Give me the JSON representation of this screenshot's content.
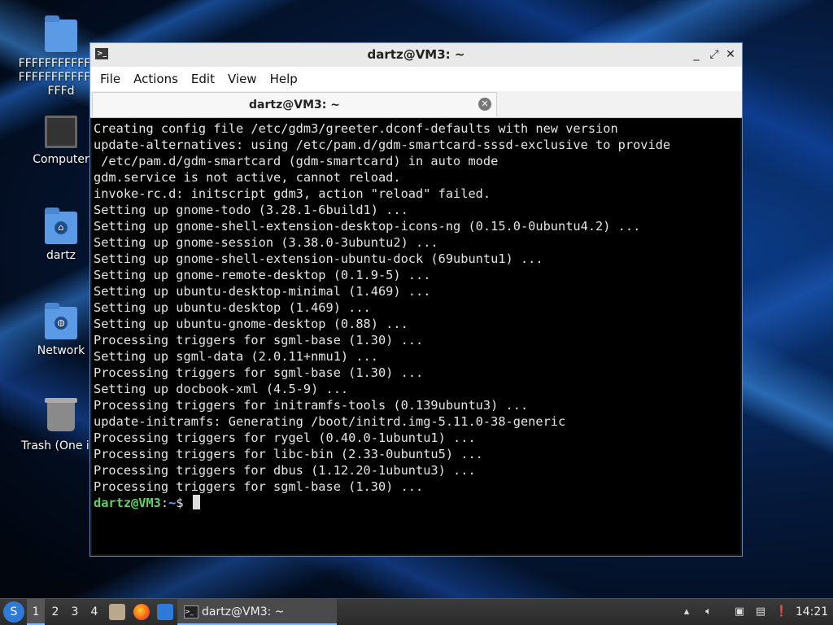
{
  "desktop": {
    "icons": [
      {
        "label": "FFFFFFFFFFFFFFFFFFFFFFFFFFFFFd"
      },
      {
        "label": "Computer"
      },
      {
        "label": "dartz"
      },
      {
        "label": "Network"
      },
      {
        "label": "Trash (One ite"
      }
    ]
  },
  "window": {
    "title": "dartz@VM3: ~",
    "controls": {
      "minimize": "_",
      "maximize": "⤢",
      "close": "✕"
    },
    "menu": [
      "File",
      "Actions",
      "Edit",
      "View",
      "Help"
    ],
    "tab": {
      "label": "dartz@VM3: ~",
      "close": "✕"
    },
    "terminal": {
      "lines": [
        "Creating config file /etc/gdm3/greeter.dconf-defaults with new version",
        "update-alternatives: using /etc/pam.d/gdm-smartcard-sssd-exclusive to provide",
        " /etc/pam.d/gdm-smartcard (gdm-smartcard) in auto mode",
        "gdm.service is not active, cannot reload.",
        "invoke-rc.d: initscript gdm3, action \"reload\" failed.",
        "Setting up gnome-todo (3.28.1-6build1) ...",
        "Setting up gnome-shell-extension-desktop-icons-ng (0.15.0-0ubuntu4.2) ...",
        "Setting up gnome-session (3.38.0-3ubuntu2) ...",
        "Setting up gnome-shell-extension-ubuntu-dock (69ubuntu1) ...",
        "Setting up gnome-remote-desktop (0.1.9-5) ...",
        "Setting up ubuntu-desktop-minimal (1.469) ...",
        "Setting up ubuntu-desktop (1.469) ...",
        "Setting up ubuntu-gnome-desktop (0.88) ...",
        "Processing triggers for sgml-base (1.30) ...",
        "Setting up sgml-data (2.0.11+nmu1) ...",
        "Processing triggers for sgml-base (1.30) ...",
        "Setting up docbook-xml (4.5-9) ...",
        "Processing triggers for initramfs-tools (0.139ubuntu3) ...",
        "update-initramfs: Generating /boot/initrd.img-5.11.0-38-generic",
        "Processing triggers for rygel (0.40.0-1ubuntu1) ...",
        "Processing triggers for libc-bin (2.33-0ubuntu5) ...",
        "Processing triggers for dbus (1.12.20-1ubuntu3) ...",
        "Processing triggers for sgml-base (1.30) ..."
      ],
      "prompt": {
        "user_host": "dartz@VM3",
        "sep": ":",
        "path": "~",
        "symbol": "$ "
      }
    }
  },
  "taskbar": {
    "workspaces": [
      "1",
      "2",
      "3",
      "4"
    ],
    "active_workspace": "1",
    "task": {
      "label": "dartz@VM3: ~"
    },
    "clock": "14:21"
  },
  "colors": {
    "prompt_user": "#5fd35f",
    "prompt_path": "#6aa7ff",
    "accent": "#8ab4ff"
  }
}
